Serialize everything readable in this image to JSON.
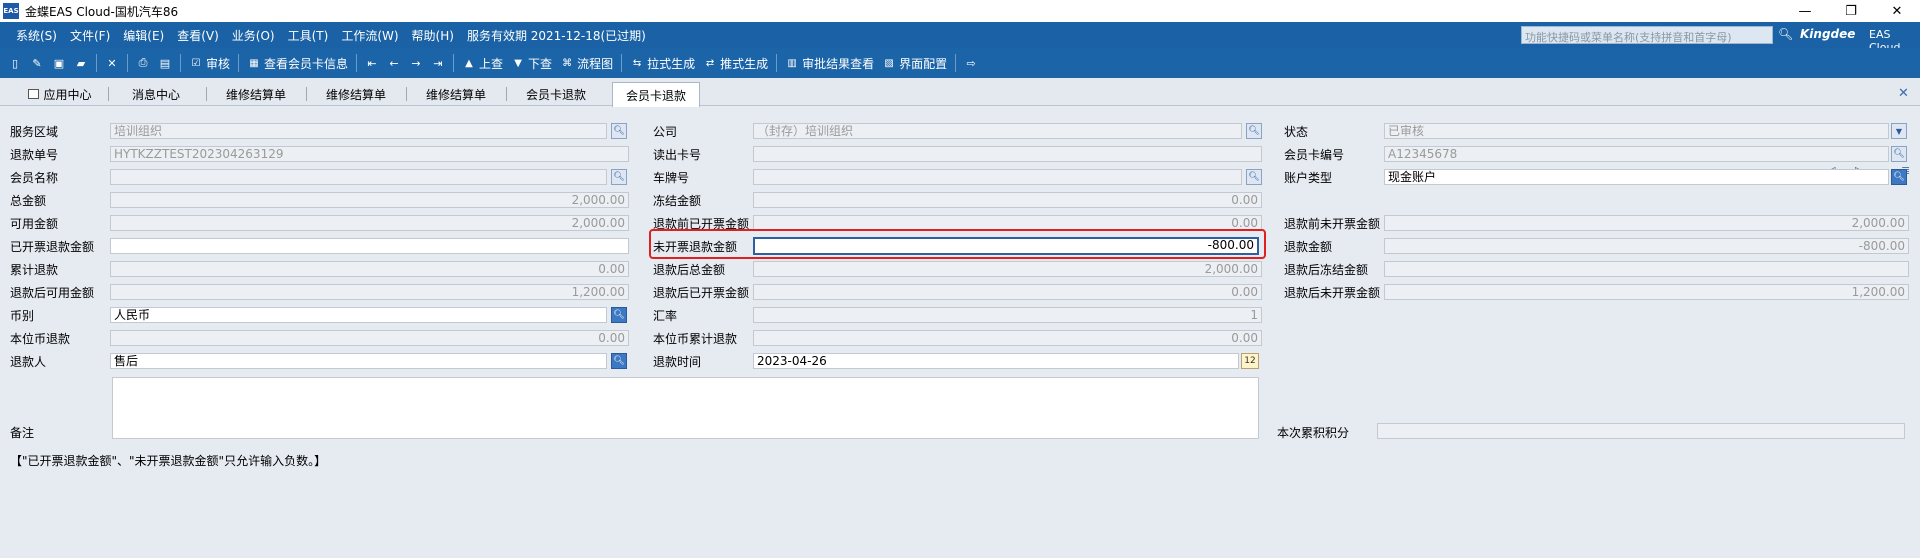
{
  "window": {
    "icon_text": "EAS",
    "title": "金蝶EAS Cloud-国机汽车86",
    "minimize": "—",
    "maximize": "❐",
    "close": "✕"
  },
  "menu": {
    "items": [
      "系统(S)",
      "文件(F)",
      "编辑(E)",
      "查看(V)",
      "业务(O)",
      "工具(T)",
      "工作流(W)",
      "帮助(H)",
      "服务有效期 2021-12-18(已过期)"
    ],
    "search_placeholder": "功能快捷码或菜单名称(支持拼音和首字母)",
    "brand": "Kingdee",
    "brand_sub": "EAS Cloud"
  },
  "toolbar": {
    "buttons": [
      "审核",
      "查看会员卡信息",
      "上查",
      "下查",
      "流程图",
      "拉式生成",
      "推式生成",
      "审批结果查看",
      "界面配置"
    ]
  },
  "tabs": [
    "应用中心",
    "消息中心",
    "维修结算单",
    "维修结算单",
    "维修结算单",
    "会员卡退款",
    "会员卡退款"
  ],
  "form": {
    "col1": {
      "service_area": {
        "label": "服务区域",
        "value": "培训组织"
      },
      "refund_no": {
        "label": "退款单号",
        "value": "HYTKZZTEST202304263129"
      },
      "member_name": {
        "label": "会员名称",
        "value": ""
      },
      "total_amount": {
        "label": "总金额",
        "value": "2,000.00"
      },
      "available_amount": {
        "label": "可用金额",
        "value": "2,000.00"
      },
      "invoiced_refund": {
        "label": "已开票退款金额",
        "value": ""
      },
      "cumulative_refund": {
        "label": "累计退款",
        "value": "0.00"
      },
      "available_after": {
        "label": "退款后可用金额",
        "value": "1,200.00"
      },
      "currency": {
        "label": "币别",
        "value": "人民币"
      },
      "local_refund": {
        "label": "本位币退款",
        "value": "0.00"
      },
      "refunder": {
        "label": "退款人",
        "value": "售后"
      },
      "remark": {
        "label": "备注",
        "value": ""
      }
    },
    "col2": {
      "company": {
        "label": "公司",
        "value": "（封存）培训组织"
      },
      "read_card_no": {
        "label": "读出卡号",
        "value": ""
      },
      "plate_no": {
        "label": "车牌号",
        "value": ""
      },
      "frozen_amount": {
        "label": "冻结金额",
        "value": "0.00"
      },
      "invoiced_before": {
        "label": "退款前已开票金额",
        "value": "0.00"
      },
      "uninvoiced_refund": {
        "label": "未开票退款金额",
        "value": "-800.00"
      },
      "total_after": {
        "label": "退款后总金额",
        "value": "2,000.00"
      },
      "invoiced_after": {
        "label": "退款后已开票金额",
        "value": "0.00"
      },
      "exchange_rate": {
        "label": "汇率",
        "value": "1"
      },
      "local_cumulative": {
        "label": "本位币累计退款",
        "value": "0.00"
      },
      "refund_time": {
        "label": "退款时间",
        "value": "2023-04-26"
      }
    },
    "col3": {
      "status": {
        "label": "状态",
        "value": "已审核"
      },
      "card_no": {
        "label": "会员卡编号",
        "value": "A12345678"
      },
      "account_type": {
        "label": "账户类型",
        "value": "现金账户"
      },
      "uninvoiced_before": {
        "label": "退款前未开票金额",
        "value": "2,000.00"
      },
      "refund_amount": {
        "label": "退款金额",
        "value": "-800.00"
      },
      "frozen_after": {
        "label": "退款后冻结金额",
        "value": ""
      },
      "uninvoiced_after": {
        "label": "退款后未开票金额",
        "value": "1,200.00"
      },
      "points": {
        "label": "本次累积积分",
        "value": ""
      }
    }
  },
  "note": "【\"已开票退款金额\"、\"未开票退款金额\"只允许输入负数。】"
}
